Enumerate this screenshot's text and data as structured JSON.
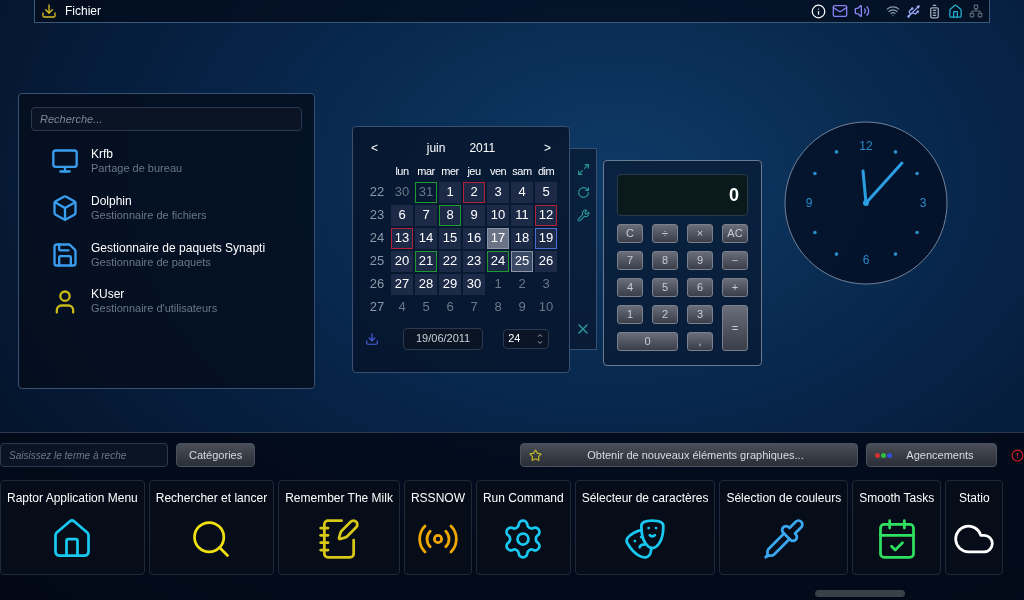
{
  "top_panel": {
    "title": "Fichier"
  },
  "launcher": {
    "search_placeholder": "Recherche...",
    "items": [
      {
        "name": "Krfb",
        "description": "Partage de bureau",
        "kind": "monitor"
      },
      {
        "name": "Dolphin",
        "description": "Gestionnaire de fichiers",
        "kind": "box"
      },
      {
        "name": "Gestionnaire de paquets Synapti",
        "description": "Gestionnaire de paquets",
        "kind": "floppy"
      },
      {
        "name": "KUser",
        "description": "Gestionnaire d'utilisateurs",
        "kind": "user"
      }
    ]
  },
  "calendar": {
    "prev": "<",
    "month": "juin",
    "year": "2011",
    "next": ">",
    "weekdays": [
      "lun",
      "mar",
      "mer",
      "jeu",
      "ven",
      "sam",
      "dim"
    ],
    "weeks": [
      {
        "number": "22",
        "days": [
          {
            "label": "30",
            "current": false,
            "selected": false
          },
          {
            "label": "31",
            "current": false,
            "selected": false,
            "color": "#1e9a2e"
          },
          {
            "label": "1",
            "current": true,
            "selected": false
          },
          {
            "label": "2",
            "current": true,
            "selected": false,
            "color": "#b3203a"
          },
          {
            "label": "3",
            "current": true,
            "selected": false
          },
          {
            "label": "4",
            "current": true,
            "selected": false
          },
          {
            "label": "5",
            "current": true,
            "selected": false
          }
        ]
      },
      {
        "number": "23",
        "days": [
          {
            "label": "6",
            "current": true,
            "selected": false
          },
          {
            "label": "7",
            "current": true,
            "selected": false
          },
          {
            "label": "8",
            "current": true,
            "selected": false,
            "color": "#1e9a2e"
          },
          {
            "label": "9",
            "current": true,
            "selected": false
          },
          {
            "label": "10",
            "current": true,
            "selected": false
          },
          {
            "label": "11",
            "current": true,
            "selected": false
          },
          {
            "label": "12",
            "current": true,
            "selected": false,
            "color": "#b3203a"
          }
        ]
      },
      {
        "number": "24",
        "days": [
          {
            "label": "13",
            "current": true,
            "selected": false,
            "color": "#b3203a"
          },
          {
            "label": "14",
            "current": true,
            "selected": false
          },
          {
            "label": "15",
            "current": true,
            "selected": false
          },
          {
            "label": "16",
            "current": true,
            "selected": false
          },
          {
            "label": "17",
            "current": true,
            "selected": false,
            "today": true
          },
          {
            "label": "18",
            "current": true,
            "selected": false
          },
          {
            "label": "19",
            "current": true,
            "selected": true
          }
        ]
      },
      {
        "number": "25",
        "days": [
          {
            "label": "20",
            "current": true,
            "selected": false
          },
          {
            "label": "21",
            "current": true,
            "selected": false,
            "color": "#1e9a2e"
          },
          {
            "label": "22",
            "current": true,
            "selected": false
          },
          {
            "label": "23",
            "current": true,
            "selected": false
          },
          {
            "label": "24",
            "current": true,
            "selected": false,
            "color": "#1e9a2e"
          },
          {
            "label": "25",
            "current": true,
            "selected": false,
            "hovered": true
          },
          {
            "label": "26",
            "current": true,
            "selected": false
          }
        ]
      },
      {
        "number": "26",
        "days": [
          {
            "label": "27",
            "current": true,
            "selected": false
          },
          {
            "label": "28",
            "current": true,
            "selected": false
          },
          {
            "label": "29",
            "current": true,
            "selected": false
          },
          {
            "label": "30",
            "current": true,
            "selected": false
          },
          {
            "label": "1",
            "current": false,
            "selected": false
          },
          {
            "label": "2",
            "current": false,
            "selected": false
          },
          {
            "label": "3",
            "current": false,
            "selected": false
          }
        ]
      },
      {
        "number": "27",
        "days": [
          {
            "label": "4",
            "current": false,
            "selected": false
          },
          {
            "label": "5",
            "current": false,
            "selected": false
          },
          {
            "label": "6",
            "current": false,
            "selected": false
          },
          {
            "label": "7",
            "current": false,
            "selected": false
          },
          {
            "label": "8",
            "current": false,
            "selected": false
          },
          {
            "label": "9",
            "current": false,
            "selected": false
          },
          {
            "label": "10",
            "current": false,
            "selected": false
          }
        ]
      }
    ],
    "date": "19/06/2011",
    "week": "24"
  },
  "calculator": {
    "display": "0",
    "keys": [
      {
        "label": "C",
        "kind": "normal"
      },
      {
        "label": "÷",
        "kind": "normal"
      },
      {
        "label": "×",
        "kind": "normal"
      },
      {
        "label": "AC",
        "kind": "normal"
      },
      {
        "label": "7",
        "kind": "normal"
      },
      {
        "label": "8",
        "kind": "normal"
      },
      {
        "label": "9",
        "kind": "normal"
      },
      {
        "label": "−",
        "kind": "normal"
      },
      {
        "label": "4",
        "kind": "normal"
      },
      {
        "label": "5",
        "kind": "normal"
      },
      {
        "label": "6",
        "kind": "normal"
      },
      {
        "label": "+",
        "kind": "normal"
      },
      {
        "label": "1",
        "kind": "normal"
      },
      {
        "label": "2",
        "kind": "normal"
      },
      {
        "label": "3",
        "kind": "normal"
      },
      {
        "label": "=",
        "kind": "tall"
      },
      {
        "label": "0",
        "kind": "wide"
      },
      {
        "label": ",",
        "kind": "normal"
      }
    ]
  },
  "clock": {
    "numbers": [
      "12",
      "3",
      "6",
      "9"
    ]
  },
  "widget_explorer": {
    "search_placeholder": "Saisissez le terme à reche",
    "categories": "Catégories",
    "get_new": "Obtenir de nouveaux éléments graphiques...",
    "layouts": "Agencements",
    "widgets": [
      {
        "name": "Raptor Application Menu",
        "kind": "home"
      },
      {
        "name": "Rechercher et lancer",
        "kind": "search"
      },
      {
        "name": "Remember The Milk",
        "kind": "note"
      },
      {
        "name": "RSSNOW",
        "kind": "broadcast"
      },
      {
        "name": "Run Command",
        "kind": "gear"
      },
      {
        "name": "Sélecteur de caractères",
        "kind": "masks"
      },
      {
        "name": "Sélection de couleurs",
        "kind": "pipette"
      },
      {
        "name": "Smooth Tasks",
        "kind": "check"
      },
      {
        "name": "Statio",
        "kind": "partial"
      }
    ]
  }
}
